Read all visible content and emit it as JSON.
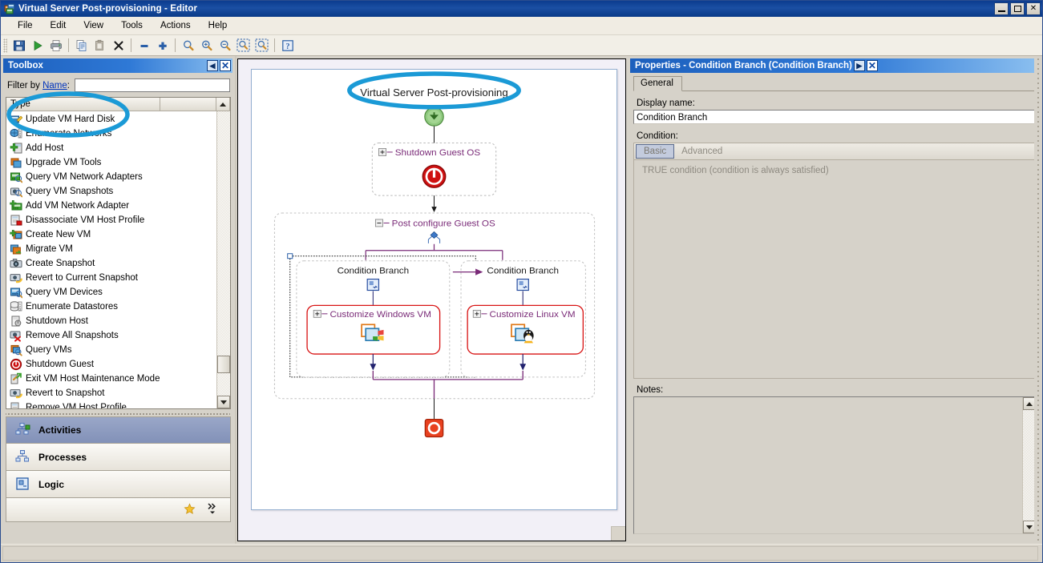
{
  "window": {
    "title": "Virtual Server Post-provisioning - Editor",
    "icon": "app-window-icon",
    "controls": {
      "minimize": "_",
      "maximize": "□",
      "close": "✕"
    }
  },
  "menu": {
    "items": [
      "File",
      "Edit",
      "View",
      "Tools",
      "Actions",
      "Help"
    ]
  },
  "toolbar": {
    "buttons": [
      {
        "name": "save-button",
        "icon": "save-icon"
      },
      {
        "name": "run-button",
        "icon": "play-icon"
      },
      {
        "name": "print-button",
        "icon": "printer-icon"
      },
      {
        "name": "copy-button",
        "icon": "copy-icon"
      },
      {
        "name": "paste-button",
        "icon": "paste-icon"
      },
      {
        "name": "delete-button",
        "icon": "delete-x-icon"
      },
      {
        "name": "collapse-button",
        "icon": "minus-icon"
      },
      {
        "name": "expand-button",
        "icon": "plus-icon"
      },
      {
        "name": "zoom-button",
        "icon": "magnifier-icon"
      },
      {
        "name": "zoom-in-button",
        "icon": "magnifier-plus-icon"
      },
      {
        "name": "zoom-out-button",
        "icon": "magnifier-minus-icon"
      },
      {
        "name": "zoom-selection-button",
        "icon": "zoom-selection-icon"
      },
      {
        "name": "zoom-fit-button",
        "icon": "zoom-fit-icon"
      },
      {
        "name": "help-button",
        "icon": "help-info-icon"
      }
    ]
  },
  "toolbox": {
    "caption": "Toolbox",
    "collapse_glyph": "◀",
    "close_glyph": "✕",
    "filter_label_prefix": "Filter by ",
    "filter_label_link": "Name",
    "filter_label_suffix": ":",
    "filter_value": "",
    "filter_placeholder": "",
    "columns": [
      "Type",
      ""
    ],
    "items": [
      {
        "label": "Update VM Hard Disk",
        "icon": "update-vm-hard-disk-icon"
      },
      {
        "label": "Enumerate Networks",
        "icon": "enumerate-networks-icon"
      },
      {
        "label": "Add Host",
        "icon": "add-host-icon"
      },
      {
        "label": "Upgrade VM Tools",
        "icon": "upgrade-vm-tools-icon"
      },
      {
        "label": "Query VM Network Adapters",
        "icon": "query-vm-network-adapters-icon"
      },
      {
        "label": "Query VM Snapshots",
        "icon": "query-vm-snapshots-icon"
      },
      {
        "label": "Add VM Network Adapter",
        "icon": "add-vm-network-adapter-icon"
      },
      {
        "label": "Disassociate VM Host Profile",
        "icon": "disassociate-vm-host-profile-icon"
      },
      {
        "label": "Create New VM",
        "icon": "create-new-vm-icon"
      },
      {
        "label": "Migrate VM",
        "icon": "migrate-vm-icon"
      },
      {
        "label": "Create Snapshot",
        "icon": "create-snapshot-icon"
      },
      {
        "label": "Revert to Current Snapshot",
        "icon": "revert-to-current-snapshot-icon"
      },
      {
        "label": "Query VM Devices",
        "icon": "query-vm-devices-icon"
      },
      {
        "label": "Enumerate Datastores",
        "icon": "enumerate-datastores-icon"
      },
      {
        "label": "Shutdown Host",
        "icon": "shutdown-host-icon"
      },
      {
        "label": "Remove All Snapshots",
        "icon": "remove-all-snapshots-icon"
      },
      {
        "label": "Query VMs",
        "icon": "query-vms-icon"
      },
      {
        "label": "Shutdown Guest",
        "icon": "shutdown-guest-icon"
      },
      {
        "label": "Exit VM Host Maintenance Mode",
        "icon": "exit-vm-host-maintenance-mode-icon"
      },
      {
        "label": "Revert to Snapshot",
        "icon": "revert-to-snapshot-icon"
      },
      {
        "label": "Remove VM Host Profile",
        "icon": "remove-vm-host-profile-icon"
      }
    ],
    "nav": [
      {
        "label": "Activities",
        "icon": "activities-icon",
        "active": true
      },
      {
        "label": "Processes",
        "icon": "processes-icon",
        "active": false
      },
      {
        "label": "Logic",
        "icon": "logic-icon",
        "active": false
      }
    ],
    "footer": {
      "favorites_icon": "star-icon",
      "overflow_icon": "chevron-double-right-icon"
    }
  },
  "canvas": {
    "workflow_title": "Virtual Server Post-provisioning",
    "nodes": {
      "start": {
        "name": "start-node",
        "icon": "green-down-arrow-icon"
      },
      "shutdown_guest_os": {
        "label": "Shutdown Guest OS",
        "expander": "+",
        "icon": "power-shutdown-icon"
      },
      "post_configure": {
        "label": "Post configure Guest OS",
        "expander": "-",
        "icon": "branch-diamond-icon"
      },
      "branch_left": {
        "label": "Condition Branch",
        "icon": "condition-branch-icon"
      },
      "branch_right": {
        "label": "Condition Branch",
        "icon": "condition-branch-icon"
      },
      "customize_windows": {
        "label": "Customize Windows VM",
        "expander": "+",
        "icon": "windows-vm-icon"
      },
      "customize_linux": {
        "label": "Customize Linux VM",
        "expander": "+",
        "icon": "linux-vm-icon"
      },
      "stop": {
        "name": "stop-node",
        "icon": "red-stop-icon"
      }
    },
    "annotation_color": "#1b9ad6"
  },
  "properties": {
    "caption": "Properties - Condition Branch (Condition Branch)",
    "expand_glyph": "▶",
    "close_glyph": "✕",
    "tabs": [
      {
        "label": "General",
        "active": true
      }
    ],
    "display_name_label": "Display name:",
    "display_name_value": "Condition Branch",
    "condition_label": "Condition:",
    "condition_tabs": [
      {
        "label": "Basic",
        "selected": true
      },
      {
        "label": "Advanced",
        "selected": false
      }
    ],
    "condition_text": "TRUE condition (condition is always satisfied)",
    "notes_label": "Notes:",
    "notes_value": ""
  },
  "status": {
    "text": ""
  }
}
